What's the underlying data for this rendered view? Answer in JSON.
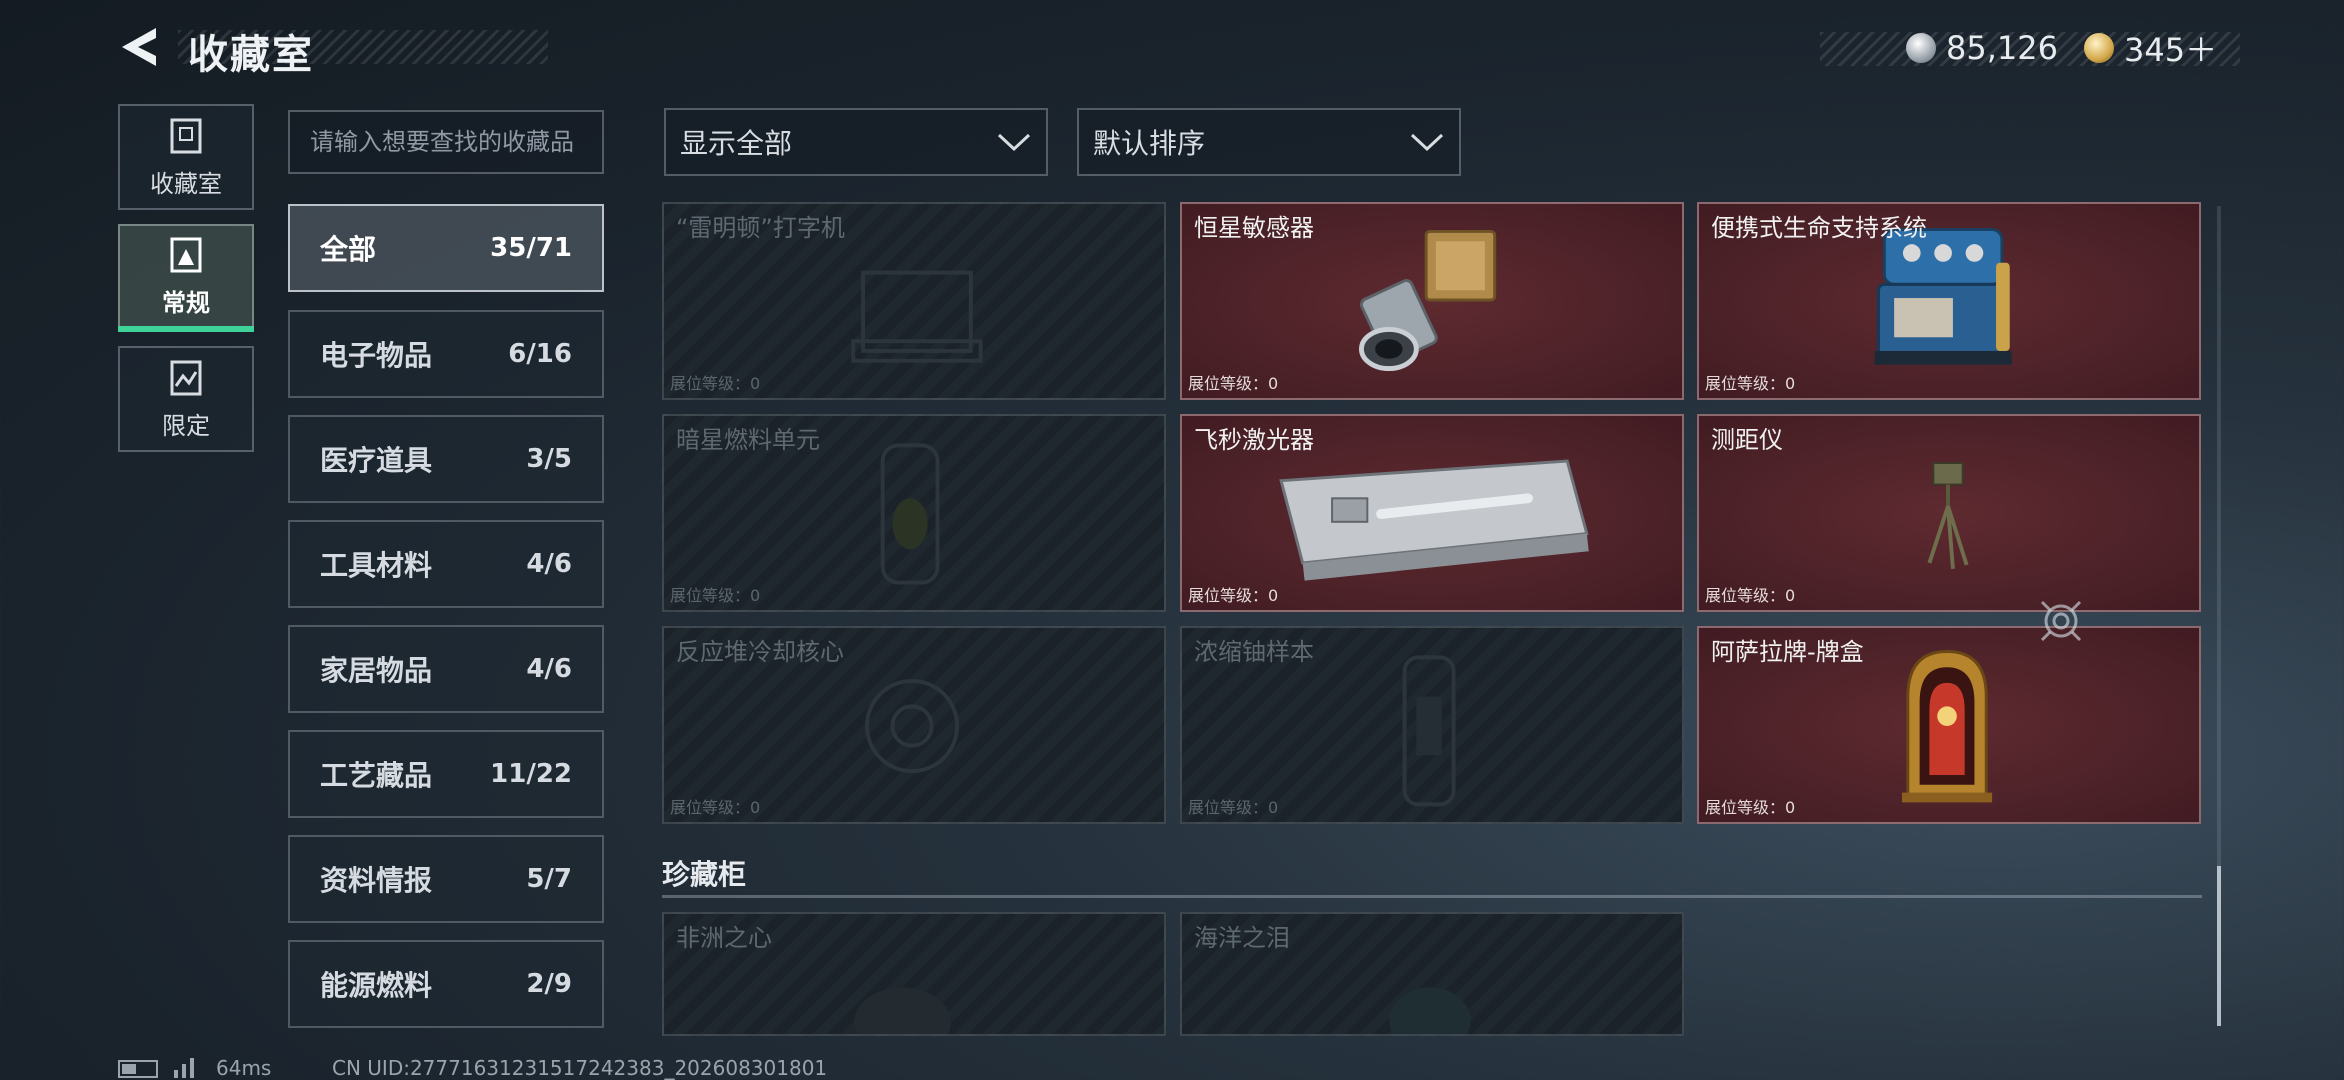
{
  "header": {
    "title": "收藏室",
    "currencies": [
      {
        "icon": "silver-coin-icon",
        "value": "85,126"
      },
      {
        "icon": "gold-coin-icon",
        "value": "345＋"
      }
    ]
  },
  "left_nav": [
    {
      "label": "收藏室",
      "icon": "collection-room-icon",
      "active": false
    },
    {
      "label": "常规",
      "icon": "regular-icon",
      "active": true
    },
    {
      "label": "限定",
      "icon": "limited-icon",
      "active": false
    }
  ],
  "search": {
    "placeholder": "请输入想要查找的收藏品"
  },
  "categories": [
    {
      "name": "全部",
      "count": "35/71",
      "active": true
    },
    {
      "name": "电子物品",
      "count": "6/16"
    },
    {
      "name": "医疗道具",
      "count": "3/5"
    },
    {
      "name": "工具材料",
      "count": "4/6"
    },
    {
      "name": "家居物品",
      "count": "4/6"
    },
    {
      "name": "工艺藏品",
      "count": "11/22"
    },
    {
      "name": "资料情报",
      "count": "5/7"
    },
    {
      "name": "能源燃料",
      "count": "2/9"
    }
  ],
  "filters": {
    "show": "显示全部",
    "sort": "默认排序"
  },
  "items": [
    {
      "name": "“雷明顿”打字机",
      "level": "展位等级：0",
      "owned": false
    },
    {
      "name": "恒星敏感器",
      "level": "展位等级：0",
      "owned": true
    },
    {
      "name": "便携式生命支持系统",
      "level": "展位等级：0",
      "owned": true
    },
    {
      "name": "暗星燃料单元",
      "level": "展位等级：0",
      "owned": false
    },
    {
      "name": "飞秒激光器",
      "level": "展位等级：0",
      "owned": true
    },
    {
      "name": "测距仪",
      "level": "展位等级：0",
      "owned": true
    },
    {
      "name": "反应堆冷却核心",
      "level": "展位等级：0",
      "owned": false
    },
    {
      "name": "浓缩铀样本",
      "level": "展位等级：0",
      "owned": false
    },
    {
      "name": "阿萨拉牌-牌盒",
      "level": "展位等级：0",
      "owned": true
    }
  ],
  "section": {
    "title": "珍藏柜",
    "items": [
      {
        "name": "非洲之心",
        "owned": false
      },
      {
        "name": "海洋之泪",
        "owned": false
      }
    ]
  },
  "status_bar": {
    "ping": "64ms",
    "uid": "CN UID:27771631231517242383_202608301801"
  },
  "colors": {
    "accent_green": "#3fd39a",
    "owned_tile": "#4a2127",
    "locked_tile": "#1b2229"
  }
}
